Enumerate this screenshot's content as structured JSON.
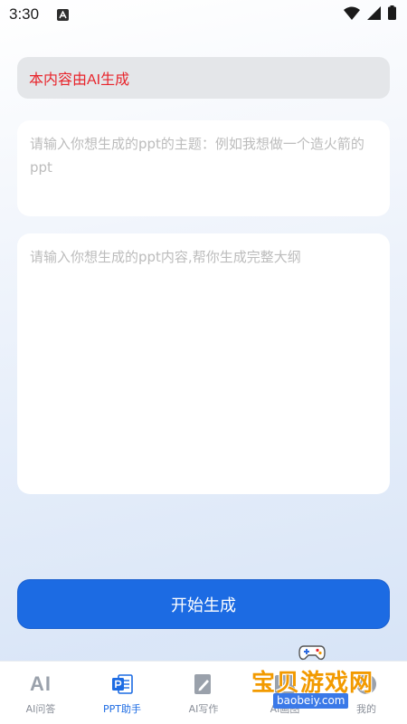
{
  "status_bar": {
    "time": "3:30",
    "app_icon": "a-icon"
  },
  "notice": {
    "text": "本内容由AI生成"
  },
  "topic": {
    "placeholder": "请输入你想生成的ppt的主题：例如我想做一个造火箭的ppt",
    "value": ""
  },
  "content": {
    "placeholder": "请输入你想生成的ppt内容,帮你生成完整大纲",
    "value": ""
  },
  "generate_button": {
    "label": "开始生成"
  },
  "bottom_nav": {
    "items": [
      {
        "label": "AI问答",
        "icon": "ai-text-icon",
        "active": false
      },
      {
        "label": "PPT助手",
        "icon": "ppt-icon",
        "active": true
      },
      {
        "label": "AI写作",
        "icon": "pen-paper-icon",
        "active": false
      },
      {
        "label": "AI画图",
        "icon": "image-icon",
        "active": false
      },
      {
        "label": "我的",
        "icon": "profile-icon",
        "active": false
      }
    ]
  },
  "watermark": {
    "text": "宝贝游戏网",
    "url": "baobeiy.com"
  },
  "colors": {
    "accent": "#1c6be3",
    "notice_text": "#e8242b",
    "watermark": "#f29a00"
  }
}
